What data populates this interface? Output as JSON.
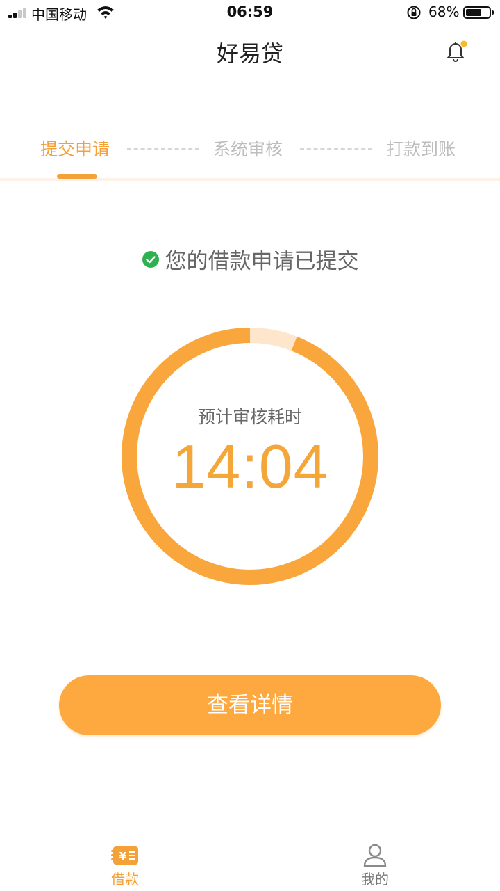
{
  "status_bar": {
    "carrier": "中国移动",
    "time": "06:59",
    "battery_percent": "68%",
    "battery_level": 0.68
  },
  "header": {
    "title": "好易贷",
    "notification_icon": "bell-icon",
    "has_unread_dot": true
  },
  "steps": [
    {
      "label": "提交申请",
      "active": true
    },
    {
      "label": "系统审核",
      "active": false
    },
    {
      "label": "打款到账",
      "active": false
    }
  ],
  "status_message": {
    "icon": "check-circle-icon",
    "text": "您的借款申请已提交"
  },
  "countdown": {
    "label": "预计审核耗时",
    "time": "14:04",
    "progress_fraction": 0.94
  },
  "details_button": {
    "label": "查看详情"
  },
  "tab_bar": {
    "tabs": [
      {
        "label": "借款",
        "icon": "loan-wallet-icon",
        "active": true
      },
      {
        "label": "我的",
        "icon": "user-profile-icon",
        "active": false
      }
    ]
  },
  "colors": {
    "accent": "#f5a139",
    "ring_track": "#fde6cc",
    "success": "#2eb24f",
    "notification_dot": "#f7b932"
  }
}
